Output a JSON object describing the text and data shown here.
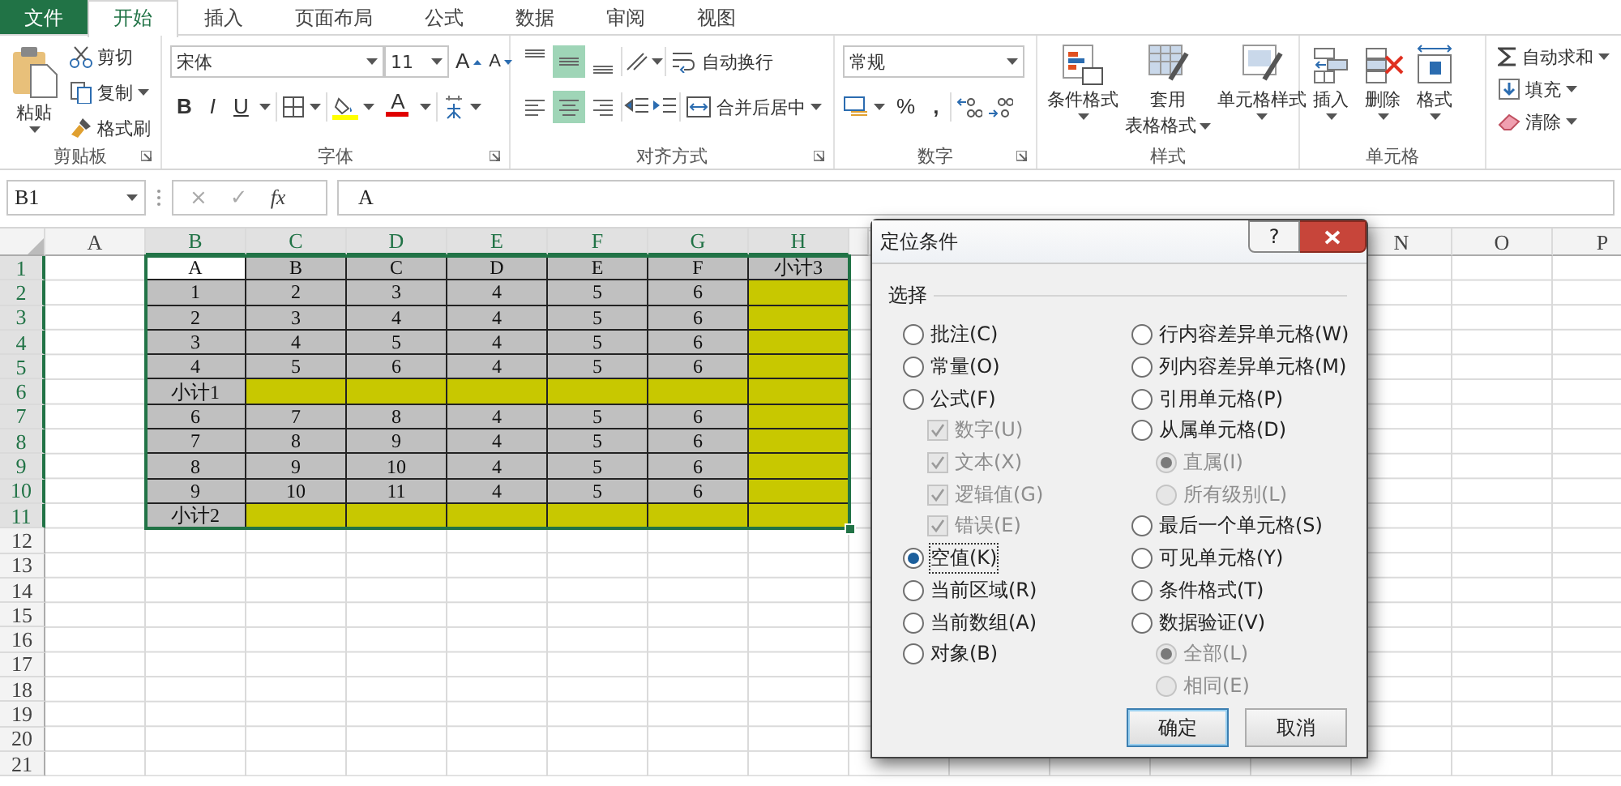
{
  "ribbon_tabs": [
    {
      "label": "文件",
      "kind": "file",
      "selected": false
    },
    {
      "label": "开始",
      "kind": "tab",
      "selected": true
    },
    {
      "label": "插入",
      "kind": "tab",
      "selected": false
    },
    {
      "label": "页面布局",
      "kind": "tab",
      "selected": false
    },
    {
      "label": "公式",
      "kind": "tab",
      "selected": false
    },
    {
      "label": "数据",
      "kind": "tab",
      "selected": false
    },
    {
      "label": "审阅",
      "kind": "tab",
      "selected": false
    },
    {
      "label": "视图",
      "kind": "tab",
      "selected": false
    }
  ],
  "ribbon": {
    "clipboard": {
      "label": "剪贴板",
      "paste": "粘贴",
      "cut": "剪切",
      "copy": "复制",
      "painter": "格式刷"
    },
    "font": {
      "label": "字体",
      "font_name": "宋体",
      "font_size": "11",
      "grow": "A",
      "shrink": "A",
      "bold": "B",
      "italic": "I",
      "underline": "U",
      "font_color": "A"
    },
    "alignment": {
      "label": "对齐方式",
      "wrap": "自动换行",
      "merge": "合并后居中",
      "vertical": [
        {
          "selected": false
        },
        {
          "selected": true
        },
        {
          "selected": false
        }
      ],
      "horizontal": [
        {
          "selected": false
        },
        {
          "selected": true
        },
        {
          "selected": false
        }
      ]
    },
    "number": {
      "label": "数字",
      "format": "常规",
      "percent": "%",
      "comma": ","
    },
    "styles": {
      "label": "样式",
      "conditional": "条件格式",
      "table_line1": "套用",
      "table_line2": "表格格式",
      "cell_styles": "单元格样式"
    },
    "cells": {
      "label": "单元格",
      "insert": "插入",
      "delete": "删除",
      "format": "格式"
    },
    "editing": {
      "autosum": "自动求和",
      "fill": "填充",
      "clear": "清除"
    }
  },
  "formula_bar": {
    "name_box": "B1",
    "cancel": "×",
    "enter": "✓",
    "fx": "fx",
    "value": "A"
  },
  "sheet": {
    "columns": [
      {
        "label": "A",
        "selected": false
      },
      {
        "label": "B",
        "selected": true
      },
      {
        "label": "C",
        "selected": true
      },
      {
        "label": "D",
        "selected": true
      },
      {
        "label": "E",
        "selected": true
      },
      {
        "label": "F",
        "selected": true
      },
      {
        "label": "G",
        "selected": true
      },
      {
        "label": "H",
        "selected": true
      }
    ],
    "columns_right": [
      {
        "label": "N",
        "selected": false
      },
      {
        "label": "O",
        "selected": false
      },
      {
        "label": "P",
        "selected": false
      }
    ],
    "rows": [
      {
        "header": "1",
        "selected": true,
        "cells": [
          {
            "text": "A",
            "color": "#ffffff"
          },
          {
            "text": "B",
            "color": "#c0c0c0"
          },
          {
            "text": "C",
            "color": "#c0c0c0"
          },
          {
            "text": "D",
            "color": "#c0c0c0"
          },
          {
            "text": "E",
            "color": "#c0c0c0"
          },
          {
            "text": "F",
            "color": "#c0c0c0"
          },
          {
            "text": "小计3",
            "color": "#c0c0c0"
          }
        ]
      },
      {
        "header": "2",
        "selected": true,
        "cells": [
          {
            "text": "1",
            "color": "#c0c0c0"
          },
          {
            "text": "2",
            "color": "#c0c0c0"
          },
          {
            "text": "3",
            "color": "#c0c0c0"
          },
          {
            "text": "4",
            "color": "#c0c0c0"
          },
          {
            "text": "5",
            "color": "#c0c0c0"
          },
          {
            "text": "6",
            "color": "#c0c0c0"
          },
          {
            "color": "#c8c800"
          }
        ]
      },
      {
        "header": "3",
        "selected": true,
        "cells": [
          {
            "text": "2",
            "color": "#c0c0c0"
          },
          {
            "text": "3",
            "color": "#c0c0c0"
          },
          {
            "text": "4",
            "color": "#c0c0c0"
          },
          {
            "text": "4",
            "color": "#c0c0c0"
          },
          {
            "text": "5",
            "color": "#c0c0c0"
          },
          {
            "text": "6",
            "color": "#c0c0c0"
          },
          {
            "color": "#c8c800"
          }
        ]
      },
      {
        "header": "4",
        "selected": true,
        "cells": [
          {
            "text": "3",
            "color": "#c0c0c0"
          },
          {
            "text": "4",
            "color": "#c0c0c0"
          },
          {
            "text": "5",
            "color": "#c0c0c0"
          },
          {
            "text": "4",
            "color": "#c0c0c0"
          },
          {
            "text": "5",
            "color": "#c0c0c0"
          },
          {
            "text": "6",
            "color": "#c0c0c0"
          },
          {
            "color": "#c8c800"
          }
        ]
      },
      {
        "header": "5",
        "selected": true,
        "cells": [
          {
            "text": "4",
            "color": "#c0c0c0"
          },
          {
            "text": "5",
            "color": "#c0c0c0"
          },
          {
            "text": "6",
            "color": "#c0c0c0"
          },
          {
            "text": "4",
            "color": "#c0c0c0"
          },
          {
            "text": "5",
            "color": "#c0c0c0"
          },
          {
            "text": "6",
            "color": "#c0c0c0"
          },
          {
            "color": "#c8c800"
          }
        ]
      },
      {
        "header": "6",
        "selected": true,
        "cells": [
          {
            "text": "小计1",
            "color": "#c0c0c0"
          },
          {
            "color": "#c8c800"
          },
          {
            "color": "#c8c800"
          },
          {
            "color": "#c8c800"
          },
          {
            "color": "#c8c800"
          },
          {
            "color": "#c8c800"
          },
          {
            "color": "#c8c800"
          }
        ]
      },
      {
        "header": "7",
        "selected": true,
        "cells": [
          {
            "text": "6",
            "color": "#c0c0c0"
          },
          {
            "text": "7",
            "color": "#c0c0c0"
          },
          {
            "text": "8",
            "color": "#c0c0c0"
          },
          {
            "text": "4",
            "color": "#c0c0c0"
          },
          {
            "text": "5",
            "color": "#c0c0c0"
          },
          {
            "text": "6",
            "color": "#c0c0c0"
          },
          {
            "color": "#c8c800"
          }
        ]
      },
      {
        "header": "8",
        "selected": true,
        "cells": [
          {
            "text": "7",
            "color": "#c0c0c0"
          },
          {
            "text": "8",
            "color": "#c0c0c0"
          },
          {
            "text": "9",
            "color": "#c0c0c0"
          },
          {
            "text": "4",
            "color": "#c0c0c0"
          },
          {
            "text": "5",
            "color": "#c0c0c0"
          },
          {
            "text": "6",
            "color": "#c0c0c0"
          },
          {
            "color": "#c8c800"
          }
        ]
      },
      {
        "header": "9",
        "selected": true,
        "cells": [
          {
            "text": "8",
            "color": "#c0c0c0"
          },
          {
            "text": "9",
            "color": "#c0c0c0"
          },
          {
            "text": "10",
            "color": "#c0c0c0"
          },
          {
            "text": "4",
            "color": "#c0c0c0"
          },
          {
            "text": "5",
            "color": "#c0c0c0"
          },
          {
            "text": "6",
            "color": "#c0c0c0"
          },
          {
            "color": "#c8c800"
          }
        ]
      },
      {
        "header": "10",
        "selected": true,
        "cells": [
          {
            "text": "9",
            "color": "#c0c0c0"
          },
          {
            "text": "10",
            "color": "#c0c0c0"
          },
          {
            "text": "11",
            "color": "#c0c0c0"
          },
          {
            "text": "4",
            "color": "#c0c0c0"
          },
          {
            "text": "5",
            "color": "#c0c0c0"
          },
          {
            "text": "6",
            "color": "#c0c0c0"
          },
          {
            "color": "#c8c800"
          }
        ]
      },
      {
        "header": "11",
        "selected": true,
        "cells": [
          {
            "text": "小计2",
            "color": "#c0c0c0"
          },
          {
            "color": "#c8c800"
          },
          {
            "color": "#c8c800"
          },
          {
            "color": "#c8c800"
          },
          {
            "color": "#c8c800"
          },
          {
            "color": "#c8c800"
          },
          {
            "color": "#c8c800"
          }
        ]
      },
      {
        "header": "12",
        "selected": false
      },
      {
        "header": "13",
        "selected": false
      },
      {
        "header": "14",
        "selected": false
      },
      {
        "header": "15",
        "selected": false
      },
      {
        "header": "16",
        "selected": false
      },
      {
        "header": "17",
        "selected": false
      },
      {
        "header": "18",
        "selected": false
      },
      {
        "header": "19",
        "selected": false
      },
      {
        "header": "20",
        "selected": false
      },
      {
        "header": "21",
        "selected": false
      }
    ]
  },
  "dialog": {
    "title": "定位条件",
    "help": "?",
    "group": "选择",
    "left": [
      {
        "label": "批注(C)",
        "kind": "radio",
        "selected": false,
        "disabled": false
      },
      {
        "label": "常量(O)",
        "kind": "radio",
        "selected": false,
        "disabled": false
      },
      {
        "label": "公式(F)",
        "kind": "radio",
        "selected": false,
        "disabled": false,
        "children": [
          {
            "label": "数字(U)",
            "kind": "checkbox",
            "checked": true,
            "disabled": true
          },
          {
            "label": "文本(X)",
            "kind": "checkbox",
            "checked": true,
            "disabled": true
          },
          {
            "label": "逻辑值(G)",
            "kind": "checkbox",
            "checked": true,
            "disabled": true
          },
          {
            "label": "错误(E)",
            "kind": "checkbox",
            "checked": true,
            "disabled": true
          }
        ]
      },
      {
        "label": "空值(K)",
        "kind": "radio",
        "selected": true,
        "disabled": false
      },
      {
        "label": "当前区域(R)",
        "kind": "radio",
        "selected": false,
        "disabled": false
      },
      {
        "label": "当前数组(A)",
        "kind": "radio",
        "selected": false,
        "disabled": false
      },
      {
        "label": "对象(B)",
        "kind": "radio",
        "selected": false,
        "disabled": false
      }
    ],
    "right": [
      {
        "label": "行内容差异单元格(W)",
        "kind": "radio",
        "selected": false,
        "disabled": false
      },
      {
        "label": "列内容差异单元格(M)",
        "kind": "radio",
        "selected": false,
        "disabled": false
      },
      {
        "label": "引用单元格(P)",
        "kind": "radio",
        "selected": false,
        "disabled": false
      },
      {
        "label": "从属单元格(D)",
        "kind": "radio",
        "selected": false,
        "disabled": false,
        "children": [
          {
            "label": "直属(I)",
            "kind": "radio",
            "selected": true,
            "disabled": true
          },
          {
            "label": "所有级别(L)",
            "kind": "radio",
            "selected": false,
            "disabled": true
          }
        ]
      },
      {
        "label": "最后一个单元格(S)",
        "kind": "radio",
        "selected": false,
        "disabled": false
      },
      {
        "label": "可见单元格(Y)",
        "kind": "radio",
        "selected": false,
        "disabled": false
      },
      {
        "label": "条件格式(T)",
        "kind": "radio",
        "selected": false,
        "disabled": false
      },
      {
        "label": "数据验证(V)",
        "kind": "radio",
        "selected": false,
        "disabled": false,
        "children": [
          {
            "label": "全部(L)",
            "kind": "radio",
            "selected": true,
            "disabled": true
          },
          {
            "label": "相同(E)",
            "kind": "radio",
            "selected": false,
            "disabled": true
          }
        ]
      }
    ],
    "buttons": [
      {
        "label": "确定",
        "kind": "default"
      },
      {
        "label": "取消",
        "kind": "normal"
      }
    ]
  }
}
